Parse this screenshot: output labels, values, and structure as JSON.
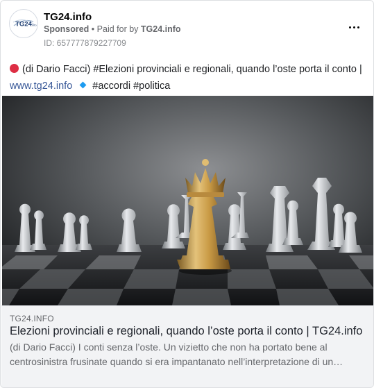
{
  "header": {
    "page_name": "TG24.info",
    "sponsored_label": "Sponsored",
    "bullet": "•",
    "paid_for_prefix": "Paid for by",
    "paid_for_by": "TG24.info",
    "ad_id": "ID: 657777879227709",
    "avatar_text": "TG24.info",
    "more_icon": "more-horizontal-icon"
  },
  "post": {
    "intro": "(di Dario Facci) #Elezioni provinciali e regionali, quando l’oste porta il conto |",
    "link": "www.tg24.info",
    "hashtags": "#accordi #politica",
    "red_dot_icon": "red-circle-icon",
    "diamond_icon": "small-blue-diamond-icon"
  },
  "image": {
    "subject": "chess-pieces-golden-queen",
    "colors": {
      "gold": "#c9a24a",
      "silver": "#c8cbd0",
      "background": "#3a3c3f"
    }
  },
  "preview": {
    "domain": "TG24.INFO",
    "headline": "Elezioni provinciali e regionali, quando l’oste porta il conto | TG24.info",
    "description": "(di Dario Facci) I conti senza l’oste. Un vizietto che non ha portato bene al centrosinistra frusinate quando si era impantanato nell’interpretazione di un…"
  },
  "colors": {
    "link": "#385898",
    "muted": "#65676b",
    "footer_bg": "#f2f3f5"
  }
}
